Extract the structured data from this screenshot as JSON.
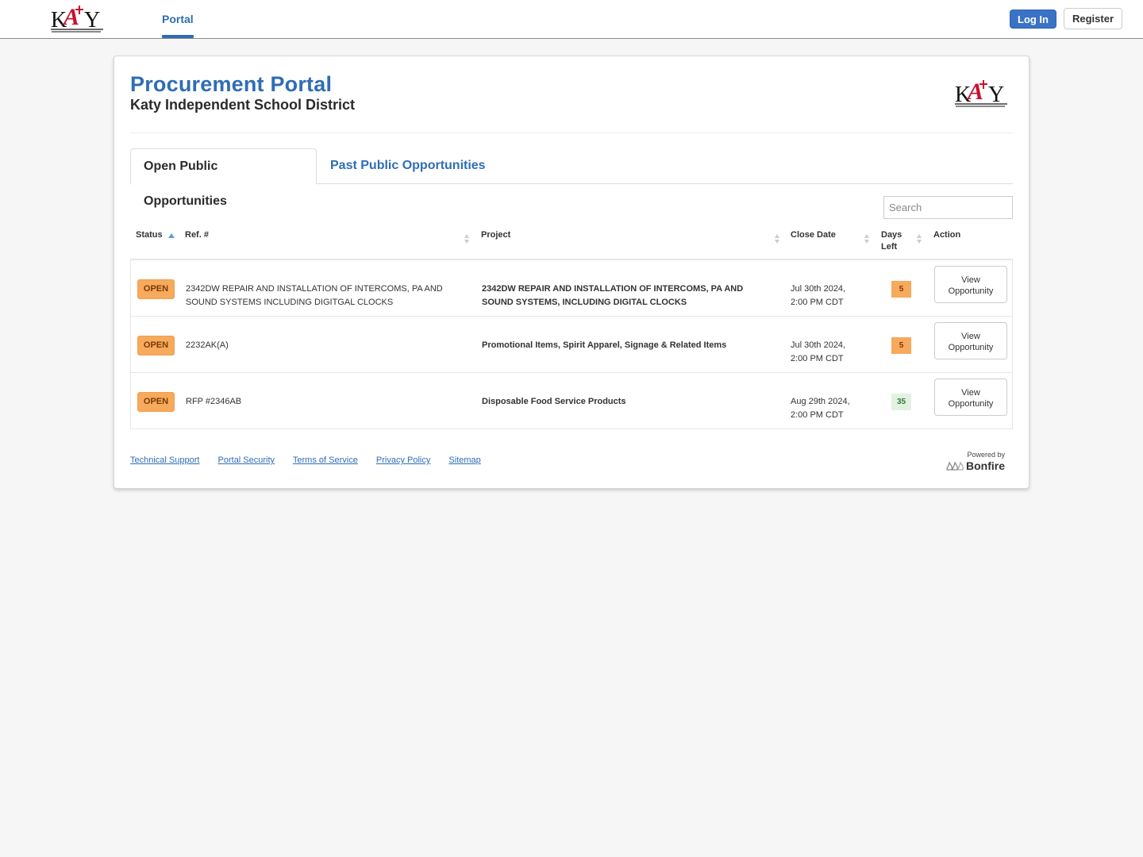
{
  "nav": {
    "logo_alt": "KATY Independent School District",
    "portal_tab": "Portal",
    "login_label": "Log In",
    "register_label": "Register"
  },
  "header": {
    "title": "Procurement Portal",
    "subtitle": "Katy Independent School District"
  },
  "tabs": [
    {
      "label": "Open Public Opportunities",
      "active": true
    },
    {
      "label": "Past Public Opportunities",
      "active": false
    }
  ],
  "search": {
    "placeholder": "Search",
    "value": ""
  },
  "table": {
    "columns": [
      "Status",
      "Ref. #",
      "Project",
      "Close Date",
      "Days Left",
      "Action"
    ],
    "columns_display": {
      "days_left_line1": "Days",
      "days_left_line2": "Left"
    },
    "sorted_by": "Status",
    "sort_direction": "ascending",
    "rows": [
      {
        "status": "OPEN",
        "ref": "2342DW REPAIR AND INSTALLATION OF INTERCOMS, PA AND SOUND SYSTEMS INCLUDING DIGITGAL CLOCKS",
        "project": "2342DW REPAIR AND INSTALLATION OF INTERCOMS, PA AND SOUND SYSTEMS, INCLUDING DIGITAL CLOCKS",
        "close_date_line1": "Jul 30th 2024,",
        "close_date_line2": "2:00 PM CDT",
        "days_left": "5",
        "action_line1": "View",
        "action_line2": "Opportunity"
      },
      {
        "status": "OPEN",
        "ref": "2232AK(A)",
        "project": "Promotional Items, Spirit Apparel, Signage & Related Items",
        "close_date_line1": "Jul 30th 2024,",
        "close_date_line2": "2:00 PM CDT",
        "days_left": "5",
        "action_line1": "View",
        "action_line2": "Opportunity"
      },
      {
        "status": "OPEN",
        "ref": "RFP #2346AB",
        "project": "Disposable Food Service Products",
        "close_date_line1": "Aug 29th 2024,",
        "close_date_line2": "2:00 PM CDT",
        "days_left": "35",
        "action_line1": "View",
        "action_line2": "Opportunity"
      }
    ]
  },
  "colors": {
    "brand_blue": "#2f6db5",
    "open_badge": "#f7a95c",
    "days_ok": "#e2f1e2",
    "logo_red": "#c8102e"
  },
  "footer": {
    "links": [
      "Technical Support",
      "Portal Security",
      "Terms of Service",
      "Privacy Policy",
      "Sitemap"
    ],
    "powered_by": "Powered by",
    "brand": "Bonfire"
  }
}
